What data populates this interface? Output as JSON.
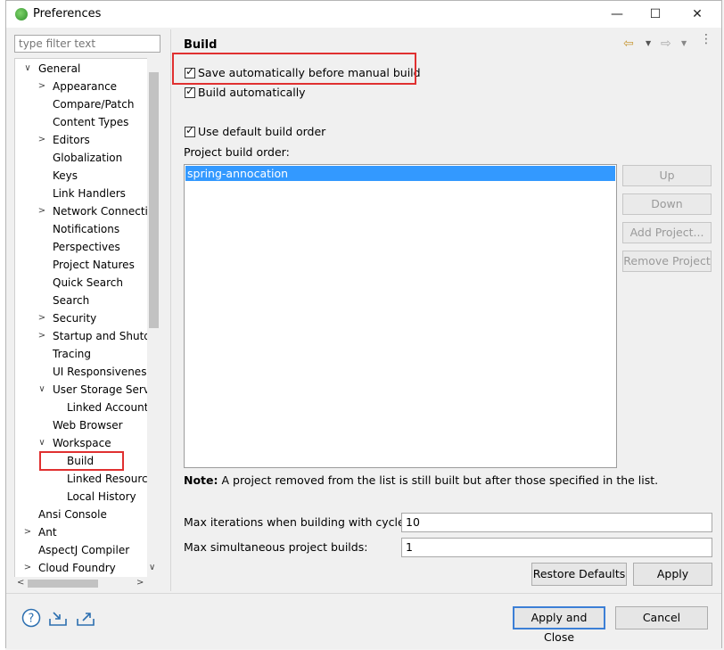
{
  "window": {
    "title": "Preferences",
    "minimize": "—",
    "maximize": "☐",
    "close": "✕"
  },
  "filter": {
    "placeholder": "type filter text"
  },
  "tree": {
    "items": [
      {
        "label": "General",
        "toggle": "∨"
      },
      {
        "label": "Appearance",
        "toggle": ">"
      },
      {
        "label": "Compare/Patch",
        "toggle": ""
      },
      {
        "label": "Content Types",
        "toggle": ""
      },
      {
        "label": "Editors",
        "toggle": ">"
      },
      {
        "label": "Globalization",
        "toggle": ""
      },
      {
        "label": "Keys",
        "toggle": ""
      },
      {
        "label": "Link Handlers",
        "toggle": ""
      },
      {
        "label": "Network Connectio",
        "toggle": ">"
      },
      {
        "label": "Notifications",
        "toggle": ""
      },
      {
        "label": "Perspectives",
        "toggle": ""
      },
      {
        "label": "Project Natures",
        "toggle": ""
      },
      {
        "label": "Quick Search",
        "toggle": ""
      },
      {
        "label": "Search",
        "toggle": ""
      },
      {
        "label": "Security",
        "toggle": ">"
      },
      {
        "label": "Startup and Shutdo",
        "toggle": ">"
      },
      {
        "label": "Tracing",
        "toggle": ""
      },
      {
        "label": "UI Responsiveness",
        "toggle": ""
      },
      {
        "label": "User Storage Servic",
        "toggle": "∨"
      },
      {
        "label": "Linked Accounts",
        "toggle": ""
      },
      {
        "label": "Web Browser",
        "toggle": ""
      },
      {
        "label": "Workspace",
        "toggle": "∨"
      },
      {
        "label": "Build",
        "toggle": ""
      },
      {
        "label": "Linked Resource",
        "toggle": ""
      },
      {
        "label": "Local History",
        "toggle": ""
      },
      {
        "label": "Ansi Console",
        "toggle": ""
      },
      {
        "label": "Ant",
        "toggle": ">"
      },
      {
        "label": "AspectJ Compiler",
        "toggle": ""
      },
      {
        "label": "Cloud Foundry",
        "toggle": ">"
      }
    ],
    "scroll_left": "<",
    "scroll_right": ">",
    "scroll_down": "∨"
  },
  "page": {
    "title": "Build",
    "save_auto": "Save automatically before manual build",
    "build_auto": "Build automatically",
    "use_default_order": "Use default build order",
    "project_order_label": "Project build order:",
    "project_order_items": [
      "spring-annocation"
    ],
    "up": "Up",
    "down": "Down",
    "add_project": "Add Project...",
    "remove_project": "Remove Project",
    "note_bold": "Note:",
    "note_text": " A project removed from the list is still built but after those specified in the list.",
    "max_iter_label": "Max iterations when building with cycles:",
    "max_iter_value": "10",
    "max_sim_label": "Max simultaneous project builds:",
    "max_sim_value": "1",
    "restore_defaults": "Restore Defaults",
    "apply": "Apply"
  },
  "footer": {
    "apply_close": "Apply and Close",
    "cancel": "Cancel"
  },
  "colors": {
    "selection": "#3399ff",
    "highlight": "#e03030"
  }
}
